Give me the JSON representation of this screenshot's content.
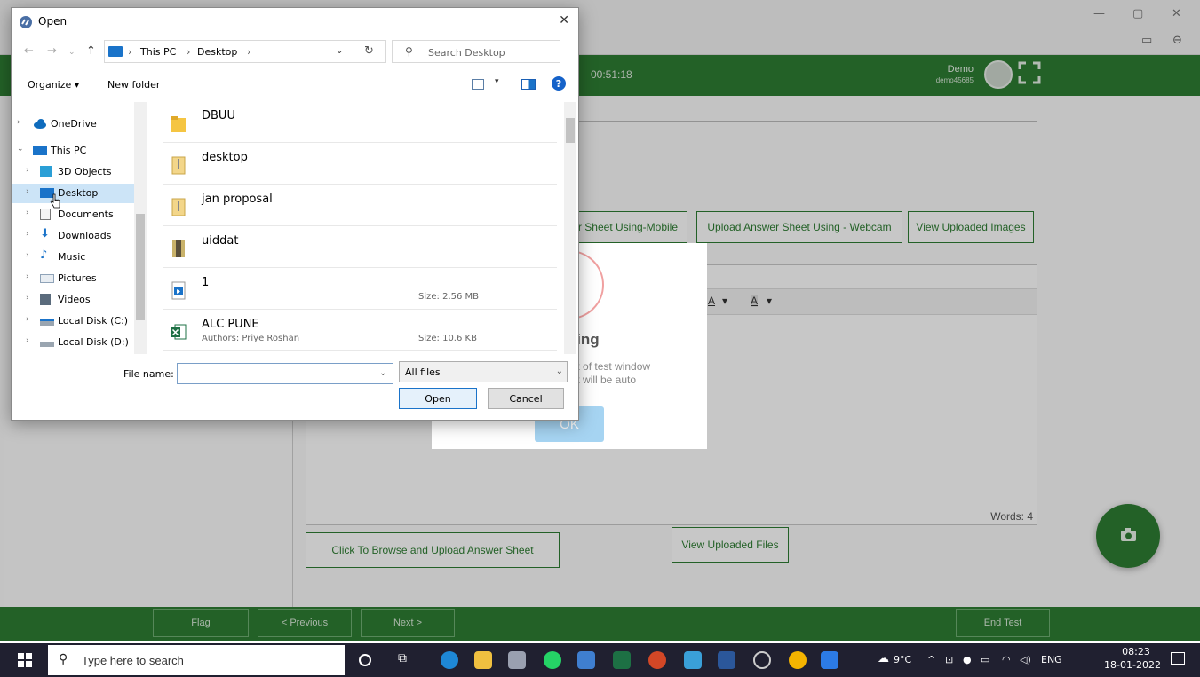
{
  "browser": {
    "window_controls": {
      "minimize": "—",
      "restore": "▢",
      "close": "✕"
    },
    "toolbar_icons": [
      "camera-icon",
      "zoom-icon"
    ]
  },
  "exam": {
    "timer": "00:51:18",
    "user": {
      "name": "Demo",
      "id": "demo45685"
    },
    "upload_buttons": [
      "r Sheet Using-Mobile",
      "Upload Answer Sheet Using - Webcam",
      "View Uploaded Images"
    ],
    "editor_tools": [
      "A",
      "A"
    ],
    "word_count": "Words: 4",
    "browse_button": "Click To Browse and Upload Answer Sheet",
    "view_files_button": "View Uploaded Files",
    "footer": {
      "flag": "Flag",
      "previous": "< Previous",
      "next": "Next >",
      "end_test": "End Test"
    },
    "theme_color": "#2e7d32"
  },
  "warning": {
    "title": "Warning",
    "message": "e out of test window\nr test will be auto\nted.",
    "ok": "OK"
  },
  "dialog": {
    "title": "Open",
    "address": {
      "crumbs": [
        "This PC",
        "Desktop"
      ],
      "sep": "›"
    },
    "search_placeholder": "Search Desktop",
    "organize": "Organize ▾",
    "new_folder": "New folder",
    "nav": [
      {
        "label": "OneDrive",
        "icon": "cloud-icon",
        "expanded": false
      },
      {
        "label": "This PC",
        "icon": "computer-icon",
        "expanded": true
      },
      {
        "label": "3D Objects",
        "icon": "cube-icon",
        "expanded": false
      },
      {
        "label": "Desktop",
        "icon": "desktop-icon",
        "expanded": false,
        "selected": true
      },
      {
        "label": "Documents",
        "icon": "documents-icon",
        "expanded": false
      },
      {
        "label": "Downloads",
        "icon": "download-icon",
        "expanded": false
      },
      {
        "label": "Music",
        "icon": "music-icon",
        "expanded": false
      },
      {
        "label": "Pictures",
        "icon": "pictures-icon",
        "expanded": false
      },
      {
        "label": "Videos",
        "icon": "videos-icon",
        "expanded": false
      },
      {
        "label": "Local Disk (C:)",
        "icon": "disk-icon",
        "expanded": false
      },
      {
        "label": "Local Disk (D:)",
        "icon": "disk-icon",
        "expanded": false
      }
    ],
    "files": [
      {
        "name": "DBUU",
        "icon": "folder-icon",
        "author": "",
        "size": ""
      },
      {
        "name": "desktop",
        "icon": "zip-folder-icon",
        "author": "",
        "size": ""
      },
      {
        "name": "jan proposal",
        "icon": "zip-folder-icon",
        "author": "",
        "size": ""
      },
      {
        "name": "uiddat",
        "icon": "archive-icon",
        "author": "",
        "size": ""
      },
      {
        "name": "1",
        "icon": "video-file-icon",
        "author": "",
        "size": "Size: 2.56 MB"
      },
      {
        "name": "ALC PUNE",
        "icon": "excel-icon",
        "author": "Authors: Priye Roshan",
        "size": "Size: 10.6 KB"
      }
    ],
    "file_name_label": "File name:",
    "file_name_value": "",
    "file_type": "All files",
    "open_button": "Open",
    "cancel_button": "Cancel"
  },
  "taskbar": {
    "search_placeholder": "Type here to search",
    "weather": "9°C",
    "language": "ENG",
    "time": "08:23",
    "date": "18-01-2022"
  }
}
